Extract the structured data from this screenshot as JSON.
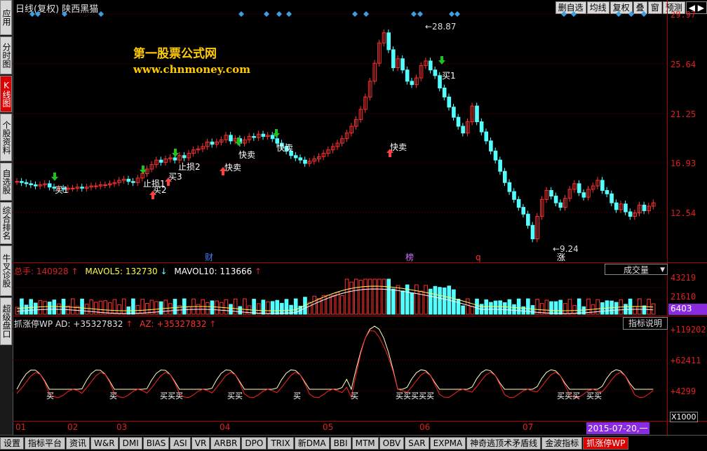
{
  "left_nav": [
    {
      "label": "应用",
      "active": false
    },
    {
      "label": "分时图",
      "active": false
    },
    {
      "label": "K线图",
      "active": true
    },
    {
      "label": "个股资料",
      "active": false
    },
    {
      "label": "自选股",
      "active": false
    },
    {
      "label": "综合排名",
      "active": false
    },
    {
      "label": "牛叉诊股",
      "active": false
    },
    {
      "label": "超级盘口",
      "active": false
    }
  ],
  "title": "日线(复权) 陕西黑猫",
  "toolbar": [
    "删自选",
    "均线",
    "复权",
    "叠",
    "窗",
    "预测"
  ],
  "toolbar_arrows": "◀ ▶",
  "watermark": {
    "line1": "第一股票公式网",
    "line2": "www.chnmoney.com"
  },
  "price_axis": [
    "29.97",
    "25.64",
    "21.25",
    "16.93",
    "12.54"
  ],
  "high_label": "28.87",
  "low_label": "9.24",
  "signals": [
    "买1",
    "买2",
    "买3",
    "止损1",
    "止损2",
    "快卖",
    "快卖",
    "快卖",
    "快卖",
    "买1",
    "快卖"
  ],
  "markers": [
    "财",
    "榜",
    "q",
    "涨"
  ],
  "volume": {
    "label": "总手",
    "total": "140928",
    "mavol5_label": "MAVOL5:",
    "mavol5": "132730",
    "mavol10_label": "MAVOL10:",
    "mavol10": "113666",
    "selector": "成交量",
    "axis": [
      "43219",
      "21610"
    ],
    "current": "6403"
  },
  "indicator": {
    "name": "抓涨停WP",
    "ad_label": "AD:",
    "ad": "+35327832",
    "az_label": "AZ:",
    "az": "+35327832",
    "desc_button": "指标说明",
    "axis": [
      "+119202",
      "+62411",
      "+4299"
    ],
    "unit": "X1000",
    "buy_labels": [
      "买",
      "买",
      "买买买",
      "买买",
      "买",
      "买",
      "买买买买买",
      "买买买",
      "买买"
    ]
  },
  "months": [
    "01",
    "02",
    "03",
    "04",
    "05",
    "06",
    "07"
  ],
  "date_badge": "2015-07-20,一",
  "bottom_tabs": [
    {
      "label": "设置",
      "active": false
    },
    {
      "label": "指标平台",
      "active": false
    },
    {
      "label": "资讯",
      "active": false
    },
    {
      "label": "W&R",
      "active": false
    },
    {
      "label": "DMI",
      "active": false
    },
    {
      "label": "BIAS",
      "active": false
    },
    {
      "label": "ASI",
      "active": false
    },
    {
      "label": "VR",
      "active": false
    },
    {
      "label": "ARBR",
      "active": false
    },
    {
      "label": "DPO",
      "active": false
    },
    {
      "label": "TRIX",
      "active": false
    },
    {
      "label": "新DMA",
      "active": false
    },
    {
      "label": "BBI",
      "active": false
    },
    {
      "label": "MTM",
      "active": false
    },
    {
      "label": "OBV",
      "active": false
    },
    {
      "label": "SAR",
      "active": false
    },
    {
      "label": "EXPMA",
      "active": false
    },
    {
      "label": "神奇逃顶术矛盾线",
      "active": false
    },
    {
      "label": "金波指标",
      "active": false
    },
    {
      "label": "抓涨停WP",
      "active": true
    }
  ],
  "colors": {
    "up": "#ff3030",
    "down": "#54ffff",
    "axis": "#aa0000",
    "accent": "#8a2be2"
  }
}
